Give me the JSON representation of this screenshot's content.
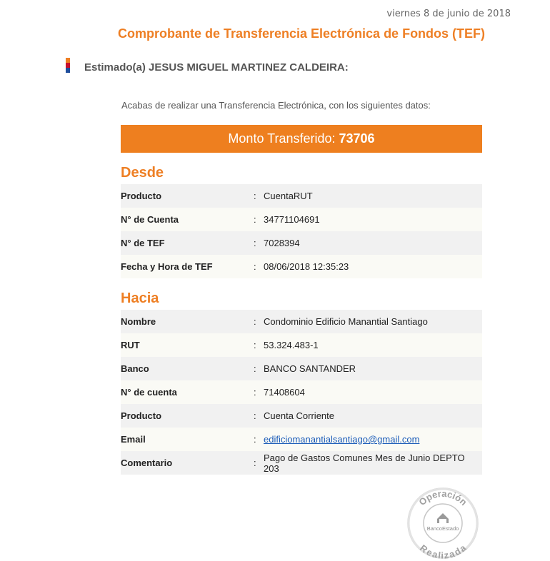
{
  "date": "viernes 8 de junio de 2018",
  "title": "Comprobante de Transferencia Electrónica de Fondos (TEF)",
  "greeting": "Estimado(a) JESUS MIGUEL MARTINEZ CALDEIRA:",
  "intro": "Acabas de realizar una Transferencia Electrónica, con los siguientes datos:",
  "amount": {
    "label": "Monto Transferido:",
    "value": "73706"
  },
  "separator": ":",
  "desde": {
    "heading": "Desde",
    "rows": [
      {
        "label": "Producto",
        "value": "CuentaRUT"
      },
      {
        "label": "N° de Cuenta",
        "value": "34771104691"
      },
      {
        "label": "N° de TEF",
        "value": "7028394"
      },
      {
        "label": "Fecha y Hora de TEF",
        "value": "08/06/2018 12:35:23"
      }
    ]
  },
  "hacia": {
    "heading": "Hacia",
    "rows": [
      {
        "label": "Nombre",
        "value": "Condominio Edificio Manantial Santiago"
      },
      {
        "label": "RUT",
        "value": "53.324.483-1"
      },
      {
        "label": "Banco",
        "value": "BANCO SANTANDER"
      },
      {
        "label": "N° de cuenta",
        "value": "71408604"
      },
      {
        "label": "Producto",
        "value": "Cuenta Corriente"
      },
      {
        "label": "Email",
        "value": "edificiomanantialsantiago@gmail.com"
      },
      {
        "label": "Comentario",
        "value": "Pago de Gastos Comunes Mes de Junio DEPTO 203"
      }
    ]
  },
  "stamp": {
    "top_text": "Operación",
    "bottom_text": "Realizada",
    "brand": "BancoEstado"
  },
  "colors": {
    "accent": "#ee7f24",
    "flag": [
      "#ee7f24",
      "#c8102e",
      "#1f4e9c"
    ]
  }
}
